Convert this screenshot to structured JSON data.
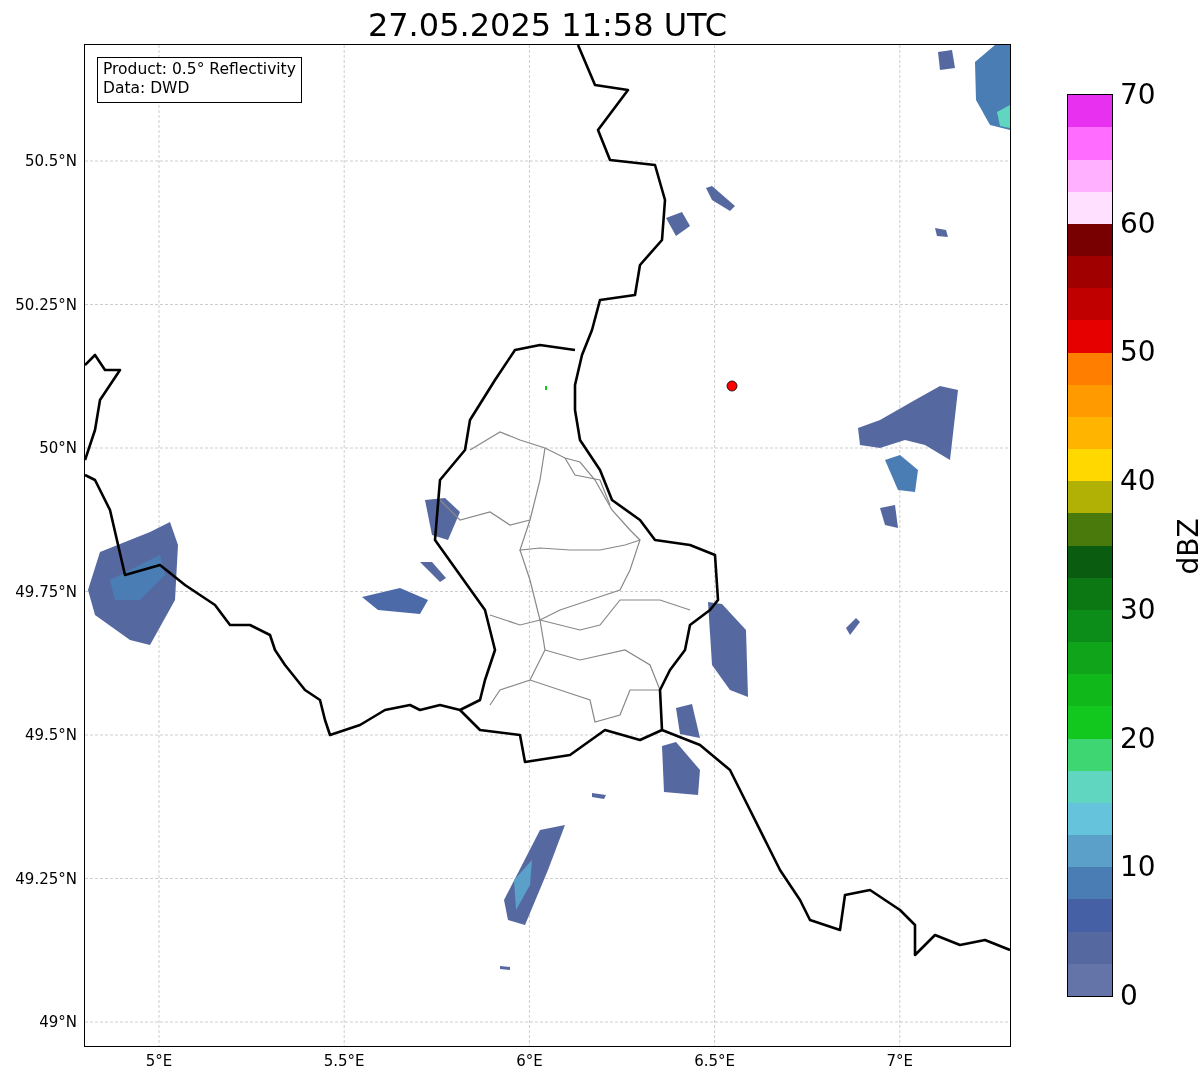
{
  "title": "27.05.2025 11:58 UTC",
  "map": {
    "legend": [
      "Product: 0.5° Reflectivity",
      "Data: DWD"
    ],
    "x_ticks": [
      "5°E",
      "5.5°E",
      "6°E",
      "6.5°E",
      "7°E"
    ],
    "y_ticks": [
      "50.5°N",
      "50.25°N",
      "50°N",
      "49.75°N",
      "49.5°N",
      "49.25°N",
      "49°N"
    ]
  },
  "colorbar": {
    "label": "dBZ",
    "ticks": [
      "70",
      "60",
      "50",
      "40",
      "30",
      "20",
      "10",
      "0"
    ],
    "bins": [
      {
        "color": "#6574a8"
      },
      {
        "color": "#5668a0"
      },
      {
        "color": "#4560a4"
      },
      {
        "color": "#4b7db5"
      },
      {
        "color": "#5aa0c8"
      },
      {
        "color": "#66c3dc"
      },
      {
        "color": "#60d6c0"
      },
      {
        "color": "#3dd672"
      },
      {
        "color": "#12c81e"
      },
      {
        "color": "#10b81a"
      },
      {
        "color": "#0fa41a"
      },
      {
        "color": "#0c8c18"
      },
      {
        "color": "#0b7814"
      },
      {
        "color": "#0a5c10"
      },
      {
        "color": "#4a7a0c"
      },
      {
        "color": "#b0b005"
      },
      {
        "color": "#ffd800"
      },
      {
        "color": "#ffb400"
      },
      {
        "color": "#ff9a00"
      },
      {
        "color": "#ff7e00"
      },
      {
        "color": "#e60000"
      },
      {
        "color": "#c00000"
      },
      {
        "color": "#a00000"
      },
      {
        "color": "#780000"
      },
      {
        "color": "#ffe0ff"
      },
      {
        "color": "#ffb0ff"
      },
      {
        "color": "#ff6cff"
      },
      {
        "color": "#e830f0"
      }
    ]
  }
}
